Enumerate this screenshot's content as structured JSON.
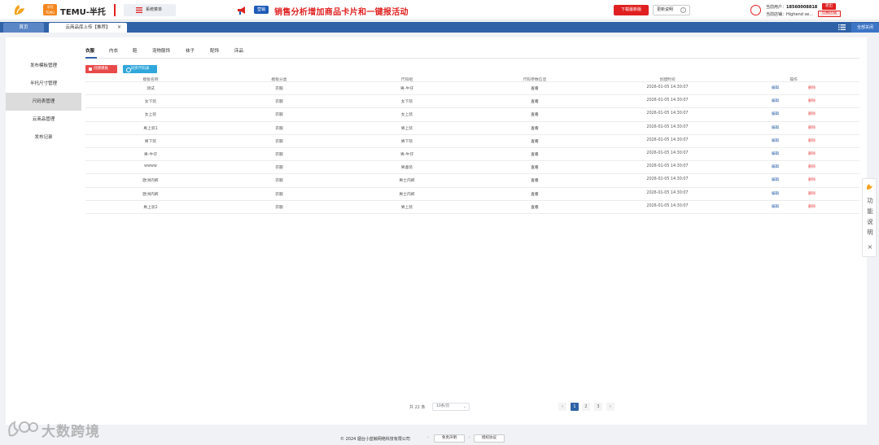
{
  "header": {
    "logo_box_text": "半托 TEMU",
    "brand": "TEMU-半托",
    "system_menu": "系统菜单",
    "promo_tag": "营销",
    "promo_text": "销售分析增加商品卡片和一键报活动",
    "download_button": "下载最新版",
    "update_button": "更新说明",
    "user_label": "当前用户：",
    "user_phone": "18560008818",
    "store_label": "当前店铺：",
    "store_name": "Highend se...",
    "logout_button": "退出",
    "switch_store_button": "切换店铺"
  },
  "tabbar": {
    "home_tab": "首页",
    "active_tab": "云商品库上传【推荐】",
    "close_all": "全部关闭"
  },
  "sidebar": {
    "items": [
      {
        "label": "发布模板管理"
      },
      {
        "label": "半托尺寸管理"
      },
      {
        "label": "尺码表管理"
      },
      {
        "label": "云商品管理"
      },
      {
        "label": "发布记录"
      }
    ]
  },
  "subtabs": [
    "衣服",
    "内衣",
    "鞋",
    "宠物服饰",
    "袜子",
    "配饰",
    "床品"
  ],
  "toolbar": {
    "create_template": "创建模板",
    "sync_size_table": "同步尺码表"
  },
  "table": {
    "headers": [
      "模板名称",
      "模板分类",
      "尺码组",
      "尺码参数信息",
      "创建时间",
      "操作"
    ],
    "rows": [
      {
        "name": "测试",
        "category": "衣服",
        "size_group": "男-牛仔",
        "info": "查看",
        "created": "2026-01-05 14:30:07",
        "edit": "编辑",
        "delete": "删除"
      },
      {
        "name": "女下装",
        "category": "衣服",
        "size_group": "女下装",
        "info": "查看",
        "created": "2026-01-05 14:30:07",
        "edit": "编辑",
        "delete": "删除"
      },
      {
        "name": "女上装",
        "category": "衣服",
        "size_group": "女上装",
        "info": "查看",
        "created": "2026-01-05 14:30:07",
        "edit": "编辑",
        "delete": "删除"
      },
      {
        "name": "男上装1",
        "category": "衣服",
        "size_group": "男上装",
        "info": "查看",
        "created": "2026-01-05 14:30:07",
        "edit": "编辑",
        "delete": "删除"
      },
      {
        "name": "男下装",
        "category": "衣服",
        "size_group": "男下装",
        "info": "查看",
        "created": "2026-01-05 14:30:07",
        "edit": "编辑",
        "delete": "删除"
      },
      {
        "name": "男-牛仔",
        "category": "衣服",
        "size_group": "男-牛仔",
        "info": "查看",
        "created": "2026-01-05 14:30:07",
        "edit": "编辑",
        "delete": "删除"
      },
      {
        "name": "wwww",
        "category": "衣服",
        "size_group": "男童装",
        "info": "查看",
        "created": "2026-01-05 14:30:07",
        "edit": "编辑",
        "delete": "删除"
      },
      {
        "name": "欧洲内裤",
        "category": "衣服",
        "size_group": "男士内裤",
        "info": "查看",
        "created": "2026-01-05 14:30:07",
        "edit": "编辑",
        "delete": "删除"
      },
      {
        "name": "欧洲内裤",
        "category": "衣服",
        "size_group": "男士内裤",
        "info": "查看",
        "created": "2026-01-05 14:30:07",
        "edit": "编辑",
        "delete": "删除"
      },
      {
        "name": "男上装2",
        "category": "衣服",
        "size_group": "男上装",
        "info": "查看",
        "created": "2026-01-05 14:30:07",
        "edit": "编辑",
        "delete": "删除"
      }
    ]
  },
  "pager": {
    "total": "共 22 条",
    "page_size": "10条/页",
    "pages": [
      "1",
      "2",
      "3"
    ],
    "current_page": "1"
  },
  "help": {
    "text": "功能说明"
  },
  "footer": {
    "copyright": "© 2024 烟台小蓝鲸网络科技有限公司",
    "disclaimer": "免责声明",
    "license": "授权协议"
  },
  "watermark": "大数跨境",
  "colors": {
    "brand_red": "#e02020",
    "primary_blue": "#2f62a7",
    "sync_blue": "#2fa7dc"
  }
}
